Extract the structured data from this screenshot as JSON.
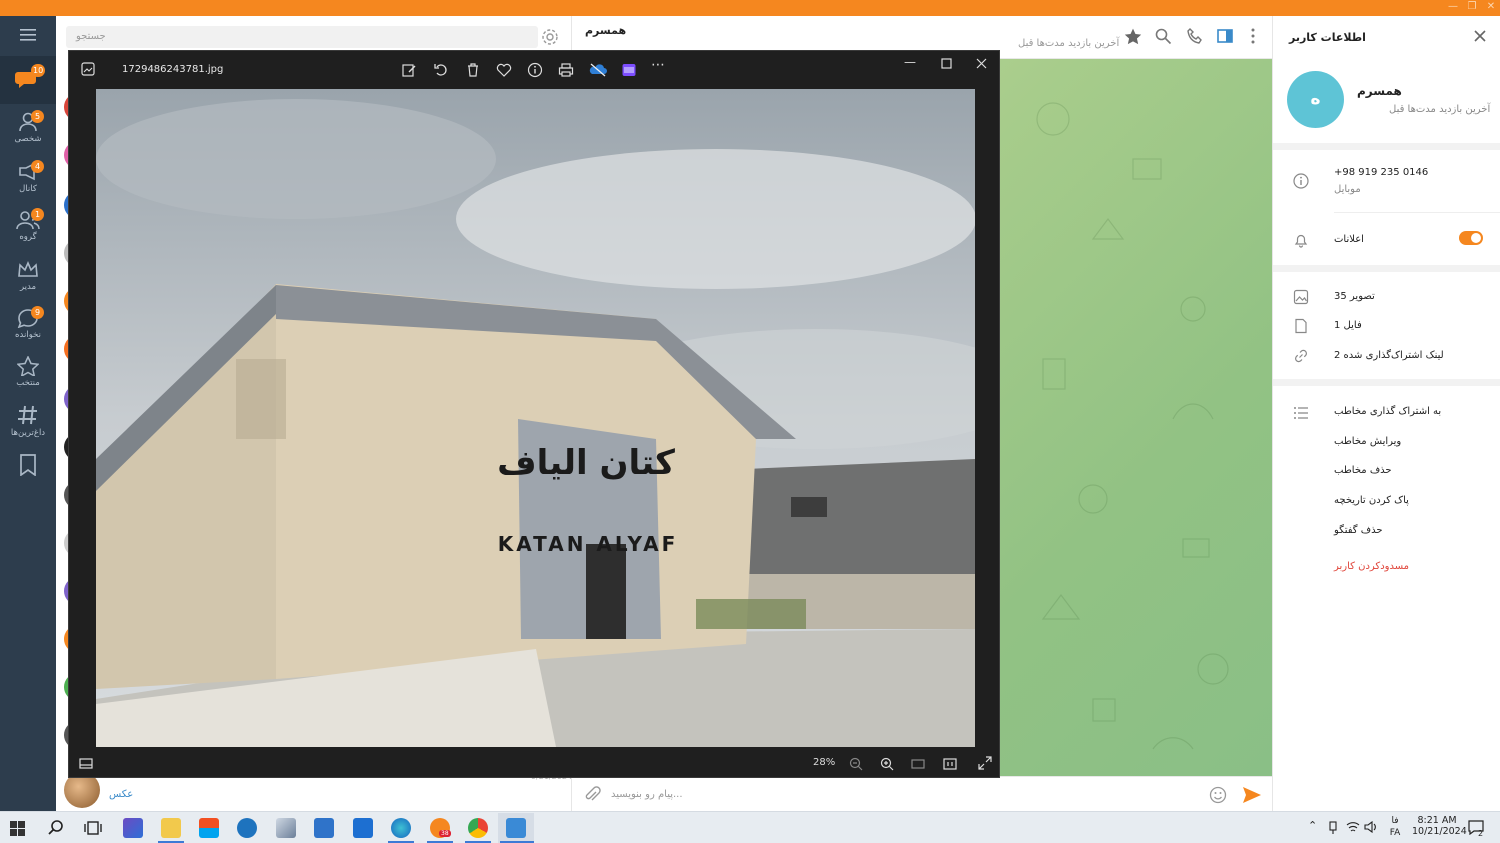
{
  "app": {
    "accent": "#f5871f"
  },
  "leftnav": {
    "items": [
      {
        "label": "",
        "badge": "10",
        "icon": "chat-bubbles-icon"
      },
      {
        "label": "شخصی",
        "badge": "5",
        "icon": "person-icon"
      },
      {
        "label": "کانال",
        "badge": "4",
        "icon": "megaphone-icon"
      },
      {
        "label": "گروه",
        "badge": "1",
        "icon": "group-icon"
      },
      {
        "label": "مدیر",
        "badge": "",
        "icon": "crown-icon"
      },
      {
        "label": "نخوانده",
        "badge": "9",
        "icon": "unread-bubble-icon"
      },
      {
        "label": "منتخب",
        "badge": "",
        "icon": "star-icon"
      },
      {
        "label": "داغ‌ترین‌ها",
        "badge": "",
        "icon": "hashtag-icon"
      },
      {
        "label": "",
        "badge": "",
        "icon": "bookmark-icon"
      }
    ]
  },
  "chatlist": {
    "search_placeholder": "جستجو",
    "last_item": {
      "subtitle": "عکس",
      "time": "9/21/2024"
    }
  },
  "chat": {
    "name": "همسرم",
    "status": "آخرین بازدید مدت‌ها قبل",
    "compose_placeholder": "پیام رو بنویسید..."
  },
  "userinfo": {
    "title": "اطلاعات کاربر",
    "avatar_letter": "ه",
    "name": "همسرم",
    "last_seen": "آخرین بازدید مدت‌ها قبل",
    "phone": "+98 919 235 0146",
    "phone_label": "موبایل",
    "notifications_label": "اعلانات",
    "notifications_on": true,
    "media": [
      {
        "label": "35 تصویر",
        "icon": "image-icon"
      },
      {
        "label": "1 فایل",
        "icon": "file-icon"
      },
      {
        "label": "2 لینک اشتراک‌گذاری شده",
        "icon": "link-icon"
      }
    ],
    "actions": [
      "به اشتراک گذاری مخاطب",
      "ویرایش مخاطب",
      "حذف مخاطب",
      "پاک کردن تاریخچه",
      "حذف گفتگو"
    ],
    "block_label": "مسدودکردن کاربر",
    "block_color": "#e0453a"
  },
  "viewer": {
    "filename": "1729486243781.jpg",
    "zoom": "28%",
    "photo_sign_fa": "کتان الیاف",
    "photo_sign_en": "KATAN ALYAF"
  },
  "taskbar": {
    "time": "8:21 AM",
    "date": "10/21/2024",
    "lang_top": "فا",
    "lang_bottom": "FA",
    "notif_count": "2",
    "mail_badge": "38"
  }
}
